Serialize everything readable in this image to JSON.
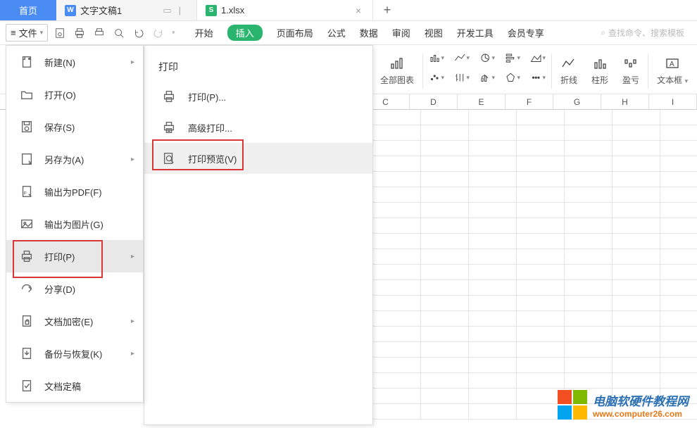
{
  "tabs": {
    "home": "首页",
    "doc": "文字文稿1",
    "xls": "1.xlsx"
  },
  "file_button": "文件",
  "ribbon": {
    "tabs": [
      "开始",
      "插入",
      "页面布局",
      "公式",
      "数据",
      "审阅",
      "视图",
      "开发工具",
      "会员专享"
    ],
    "search_placeholder": "查找命令、搜索模板",
    "groups": {
      "all_charts": "全部图表",
      "line": "折线",
      "bar": "柱形",
      "winloss": "盈亏",
      "textbox": "文本框"
    }
  },
  "columns": [
    "C",
    "D",
    "E",
    "F",
    "G",
    "H",
    "I"
  ],
  "file_menu": {
    "items": [
      {
        "label": "新建(N)",
        "arrow": true,
        "icon": "new"
      },
      {
        "label": "打开(O)",
        "arrow": false,
        "icon": "open"
      },
      {
        "label": "保存(S)",
        "arrow": false,
        "icon": "save"
      },
      {
        "label": "另存为(A)",
        "arrow": true,
        "icon": "saveas"
      },
      {
        "label": "输出为PDF(F)",
        "arrow": false,
        "icon": "pdf"
      },
      {
        "label": "输出为图片(G)",
        "arrow": false,
        "icon": "image"
      },
      {
        "label": "打印(P)",
        "arrow": true,
        "icon": "print",
        "selected": true
      },
      {
        "label": "分享(D)",
        "arrow": false,
        "icon": "share"
      },
      {
        "label": "文档加密(E)",
        "arrow": true,
        "icon": "lock"
      },
      {
        "label": "备份与恢复(K)",
        "arrow": true,
        "icon": "backup"
      },
      {
        "label": "文档定稿",
        "arrow": false,
        "icon": "final"
      }
    ]
  },
  "print_submenu": {
    "title": "打印",
    "items": [
      {
        "label": "打印(P)...",
        "icon": "print"
      },
      {
        "label": "高级打印...",
        "icon": "printadv"
      },
      {
        "label": "打印预览(V)",
        "icon": "preview",
        "selected": true
      }
    ]
  },
  "watermark": {
    "line1": "电脑软硬件教程网",
    "line2": "www.computer26.com"
  },
  "colors": {
    "accent_blue": "#4a8bf4",
    "accent_green": "#2ab56f",
    "highlight_red": "#d93636",
    "wm_blue": "#2b6fb5",
    "wm_orange": "#e67817"
  }
}
